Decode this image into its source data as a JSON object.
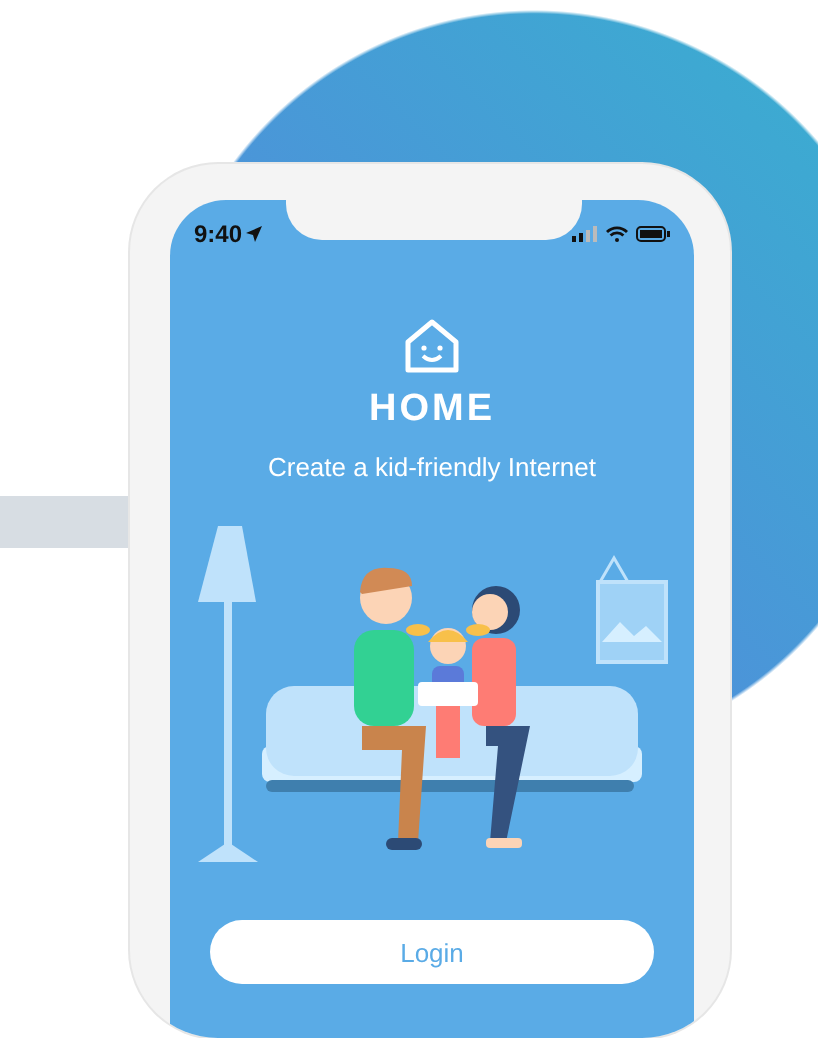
{
  "status_bar": {
    "time": "9:40"
  },
  "app": {
    "title": "HOME",
    "tagline": "Create a kid-friendly Internet"
  },
  "buttons": [
    {
      "label": "Login"
    }
  ]
}
